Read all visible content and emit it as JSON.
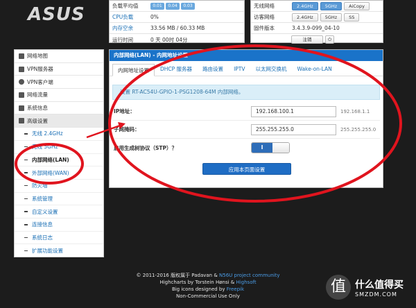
{
  "brand": {
    "logo": "ASUS"
  },
  "status_left": {
    "rows": [
      {
        "label": "负载平均值",
        "value": ""
      },
      {
        "label": "CPU负载",
        "value": "0%"
      },
      {
        "label": "内存空余",
        "value": "33.56 MB / 60.33 MB"
      },
      {
        "label": "运行时间",
        "value": "0 天 00时 04分"
      }
    ],
    "load_badges": [
      "0.01",
      "0.04",
      "0.03"
    ]
  },
  "status_right": {
    "rows": [
      {
        "label": "无线网络",
        "buttons": [
          "2.4GHz",
          "5GHz",
          "AiCopy"
        ]
      },
      {
        "label": "访客网络",
        "buttons": [
          "2.4GHz",
          "5GHz",
          "SS"
        ]
      },
      {
        "label": "固件版本",
        "value": "3.4.3.9-099_04-10"
      }
    ],
    "logout_label": "注销",
    "power_icon": "power-icon"
  },
  "sidebar": {
    "items": [
      {
        "label": "网络地图",
        "icon": "network-map-icon"
      },
      {
        "label": "VPN服务器",
        "icon": "vpn-server-icon"
      },
      {
        "label": "VPN客户端",
        "icon": "vpn-client-icon"
      },
      {
        "label": "网络流量",
        "icon": "traffic-icon"
      },
      {
        "label": "系统信息",
        "icon": "system-info-icon"
      },
      {
        "label": "高级设置",
        "icon": "advanced-settings-icon"
      }
    ],
    "sub_items": [
      {
        "label": "无线 2.4GHz"
      },
      {
        "label": "无线 5GHz"
      },
      {
        "label": "内部网络(LAN)"
      },
      {
        "label": "外部网络(WAN)"
      },
      {
        "label": "防火墙"
      },
      {
        "label": "系统管理"
      },
      {
        "label": "自定义设置"
      },
      {
        "label": "连接信息"
      },
      {
        "label": "系统日志"
      },
      {
        "label": "扩展功能设置"
      }
    ]
  },
  "main": {
    "title": "内部网络(LAN) - 内网地址设置",
    "tabs": [
      "内网地址设置",
      "DHCP 服务器",
      "路由设置",
      "IPTV",
      "以太网交换机",
      "Wake-on-LAN"
    ],
    "info": "设置 RT-AC54U-GPIO-1-PSG1208-64M 内部网络。",
    "fields": [
      {
        "label": "IP地址：",
        "value": "192.168.100.1",
        "hint": "192.168.1.1"
      },
      {
        "label": "子网掩码：",
        "value": "255.255.255.0",
        "hint": "255.255.255.0"
      }
    ],
    "stp_label": "启用生成树协议（STP）？",
    "stp_toggle_on": "I",
    "apply_label": "应用本页面设置"
  },
  "footer": {
    "line1_a": "© 2011-2016 版权属于 Padavan & ",
    "line1_link": "N56U project community",
    "line2_a": "Highcharts by Torstein Hønsi & ",
    "line2_link": "Highsoft",
    "line3_a": "Big icons designed by ",
    "line3_link": "Freepik",
    "line4": "Non-Commercial Use Only"
  },
  "watermark": {
    "glyph": "值",
    "title": "什么值得买",
    "site": "SMZDM.COM"
  },
  "colors": {
    "accent": "#1a73c9",
    "annotation": "#e0141e"
  }
}
